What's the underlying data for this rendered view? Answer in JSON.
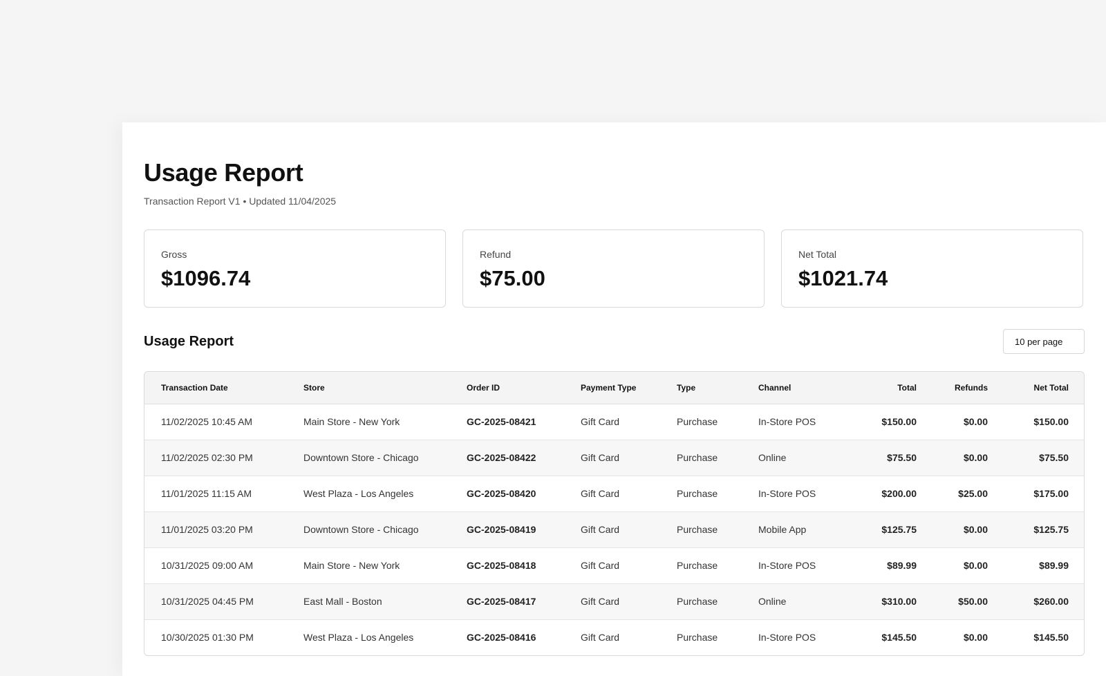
{
  "header": {
    "title": "Usage Report",
    "subtitle": "Transaction Report V1 • Updated 11/04/2025"
  },
  "summary": [
    {
      "label": "Gross",
      "value": "$1096.74"
    },
    {
      "label": "Refund",
      "value": "$75.00"
    },
    {
      "label": "Net Total",
      "value": "$1021.74"
    }
  ],
  "section": {
    "title": "Usage Report",
    "per_page": "10 per page"
  },
  "table": {
    "columns": [
      "Transaction Date",
      "Store",
      "Order ID",
      "Payment Type",
      "Type",
      "Channel",
      "Total",
      "Refunds",
      "Net Total"
    ],
    "rows": [
      [
        "11/02/2025 10:45 AM",
        "Main Store - New York",
        "GC-2025-08421",
        "Gift Card",
        "Purchase",
        "In-Store POS",
        "$150.00",
        "$0.00",
        "$150.00"
      ],
      [
        "11/02/2025 02:30 PM",
        "Downtown Store - Chicago",
        "GC-2025-08422",
        "Gift Card",
        "Purchase",
        "Online",
        "$75.50",
        "$0.00",
        "$75.50"
      ],
      [
        "11/01/2025 11:15 AM",
        "West Plaza - Los Angeles",
        "GC-2025-08420",
        "Gift Card",
        "Purchase",
        "In-Store POS",
        "$200.00",
        "$25.00",
        "$175.00"
      ],
      [
        "11/01/2025 03:20 PM",
        "Downtown Store - Chicago",
        "GC-2025-08419",
        "Gift Card",
        "Purchase",
        "Mobile App",
        "$125.75",
        "$0.00",
        "$125.75"
      ],
      [
        "10/31/2025 09:00 AM",
        "Main Store - New York",
        "GC-2025-08418",
        "Gift Card",
        "Purchase",
        "In-Store POS",
        "$89.99",
        "$0.00",
        "$89.99"
      ],
      [
        "10/31/2025 04:45 PM",
        "East Mall - Boston",
        "GC-2025-08417",
        "Gift Card",
        "Purchase",
        "Online",
        "$310.00",
        "$50.00",
        "$260.00"
      ],
      [
        "10/30/2025 01:30 PM",
        "West Plaza - Los Angeles",
        "GC-2025-08416",
        "Gift Card",
        "Purchase",
        "In-Store POS",
        "$145.50",
        "$0.00",
        "$145.50"
      ]
    ]
  }
}
